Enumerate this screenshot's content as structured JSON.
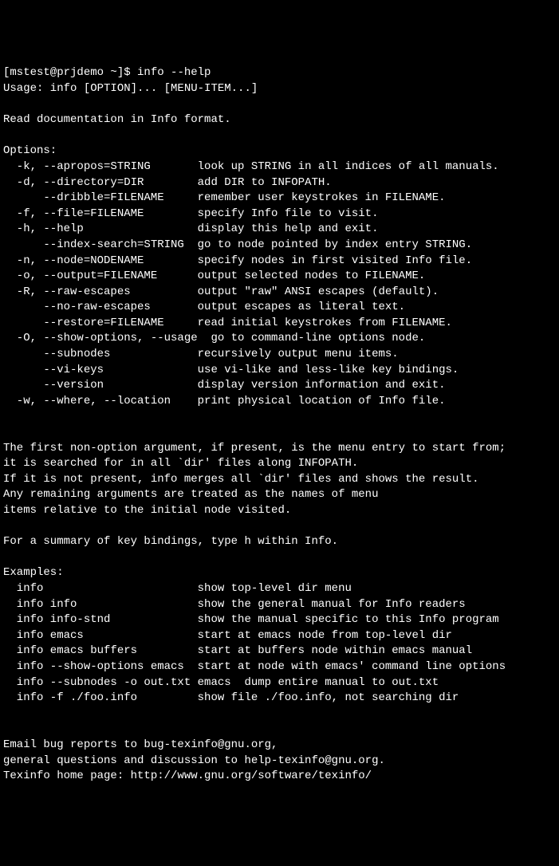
{
  "prompt": "[mstest@prjdemo ~]$ ",
  "command": "info --help",
  "usage": "Usage: info [OPTION]... [MENU-ITEM...]",
  "readDoc": "Read documentation in Info format.",
  "optionsHeader": "Options:",
  "options": [
    {
      "opt": "  -k, --apropos=STRING       ",
      "desc": "look up STRING in all indices of all manuals."
    },
    {
      "opt": "  -d, --directory=DIR        ",
      "desc": "add DIR to INFOPATH."
    },
    {
      "opt": "      --dribble=FILENAME     ",
      "desc": "remember user keystrokes in FILENAME."
    },
    {
      "opt": "  -f, --file=FILENAME        ",
      "desc": "specify Info file to visit."
    },
    {
      "opt": "  -h, --help                 ",
      "desc": "display this help and exit."
    },
    {
      "opt": "      --index-search=STRING  ",
      "desc": "go to node pointed by index entry STRING."
    },
    {
      "opt": "  -n, --node=NODENAME        ",
      "desc": "specify nodes in first visited Info file."
    },
    {
      "opt": "  -o, --output=FILENAME      ",
      "desc": "output selected nodes to FILENAME."
    },
    {
      "opt": "  -R, --raw-escapes          ",
      "desc": "output \"raw\" ANSI escapes (default)."
    },
    {
      "opt": "      --no-raw-escapes       ",
      "desc": "output escapes as literal text."
    },
    {
      "opt": "      --restore=FILENAME     ",
      "desc": "read initial keystrokes from FILENAME."
    },
    {
      "opt": "  -O, --show-options, --usage",
      "desc": "  go to command-line options node."
    },
    {
      "opt": "      --subnodes             ",
      "desc": "recursively output menu items."
    },
    {
      "opt": "      --vi-keys              ",
      "desc": "use vi-like and less-like key bindings."
    },
    {
      "opt": "      --version              ",
      "desc": "display version information and exit."
    },
    {
      "opt": "  -w, --where, --location    ",
      "desc": "print physical location of Info file."
    }
  ],
  "para1a": "The first non-option argument, if present, is the menu entry to start from;",
  "para1b": "it is searched for in all `dir' files along INFOPATH.",
  "para1c": "If it is not present, info merges all `dir' files and shows the result.",
  "para1d": "Any remaining arguments are treated as the names of menu",
  "para1e": "items relative to the initial node visited.",
  "summary": "For a summary of key bindings, type h within Info.",
  "examplesHeader": "Examples:",
  "examples": [
    {
      "cmd": "  info                       ",
      "desc": "show top-level dir menu"
    },
    {
      "cmd": "  info info                  ",
      "desc": "show the general manual for Info readers"
    },
    {
      "cmd": "  info info-stnd             ",
      "desc": "show the manual specific to this Info program"
    },
    {
      "cmd": "  info emacs                 ",
      "desc": "start at emacs node from top-level dir"
    },
    {
      "cmd": "  info emacs buffers         ",
      "desc": "start at buffers node within emacs manual"
    },
    {
      "cmd": "  info --show-options emacs  ",
      "desc": "start at node with emacs' command line options"
    },
    {
      "cmd": "  info --subnodes -o out.txt ",
      "desc": "emacs  dump entire manual to out.txt"
    },
    {
      "cmd": "  info -f ./foo.info         ",
      "desc": "show file ./foo.info, not searching dir"
    }
  ],
  "footer1": "Email bug reports to bug-texinfo@gnu.org,",
  "footer2": "general questions and discussion to help-texinfo@gnu.org.",
  "footer3": "Texinfo home page: http://www.gnu.org/software/texinfo/"
}
